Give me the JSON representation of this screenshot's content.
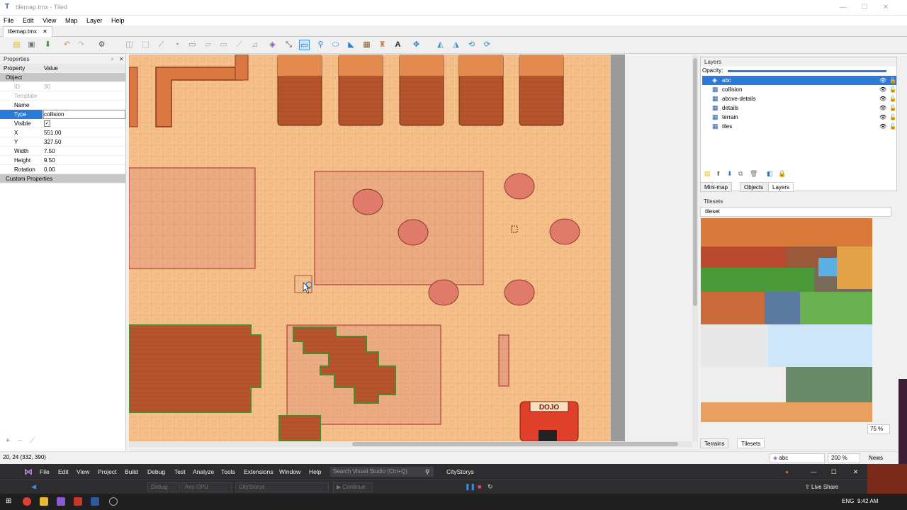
{
  "window": {
    "title": "tilemap.tmx - Tiled"
  },
  "menu": [
    "File",
    "Edit",
    "View",
    "Map",
    "Layer",
    "Help"
  ],
  "tab": {
    "label": "tilemap.tmx"
  },
  "properties": {
    "panel_title": "Properties",
    "col_property": "Property",
    "col_value": "Value",
    "group_object": "Object",
    "rows": [
      {
        "key": "ID",
        "value": "30",
        "dim": true
      },
      {
        "key": "Template",
        "value": "",
        "dim": true
      },
      {
        "key": "Name",
        "value": ""
      },
      {
        "key": "Type",
        "value": "collision",
        "selected": true
      },
      {
        "key": "Visible",
        "value": "✓"
      },
      {
        "key": "X",
        "value": "551.00"
      },
      {
        "key": "Y",
        "value": "327.50"
      },
      {
        "key": "Width",
        "value": "7.50"
      },
      {
        "key": "Height",
        "value": "9.50"
      },
      {
        "key": "Rotation",
        "value": "0.00"
      }
    ],
    "group_custom": "Custom Properties"
  },
  "layers": {
    "panel_title": "Layers",
    "opacity_label": "Opacity:",
    "items": [
      {
        "name": "abc",
        "type": "object",
        "selected": true
      },
      {
        "name": "collision",
        "type": "tile"
      },
      {
        "name": "above-details",
        "type": "tile"
      },
      {
        "name": "details",
        "type": "tile"
      },
      {
        "name": "terrain",
        "type": "tile"
      },
      {
        "name": "tiles",
        "type": "tile"
      }
    ]
  },
  "right_tabs": [
    "Mini-map",
    "Objects",
    "Layers"
  ],
  "tilesets": {
    "panel_title": "Tilesets",
    "selected": "tileset",
    "zoom": "75 %"
  },
  "bottom_tabs": [
    "Terrains",
    "Tilesets"
  ],
  "status": {
    "coords": "20, 24 (332, 390)",
    "layer_select": "abc",
    "zoom": "200 %",
    "news": "News"
  },
  "vs": {
    "menu": [
      "File",
      "Edit",
      "View",
      "Project",
      "Build",
      "Debug",
      "Test",
      "Analyze",
      "Tools",
      "Extensions",
      "Window",
      "Help"
    ],
    "search_placeholder": "Search Visual Studio (Ctrl+Q)",
    "solution": "CityStorys",
    "config": "Debug",
    "platform": "Any CPU",
    "startup": "CityStorys",
    "continue": "Continue",
    "live_share": "Live Share"
  },
  "taskbar": {
    "time": "9:42 AM",
    "lang": "ENG"
  },
  "map": {
    "sign_text": "DOJO"
  },
  "colors": {
    "accent": "#2b7ad7",
    "floor": "#f6c08a",
    "roof": "#b5542d",
    "collision_stroke": "#a8282d"
  }
}
